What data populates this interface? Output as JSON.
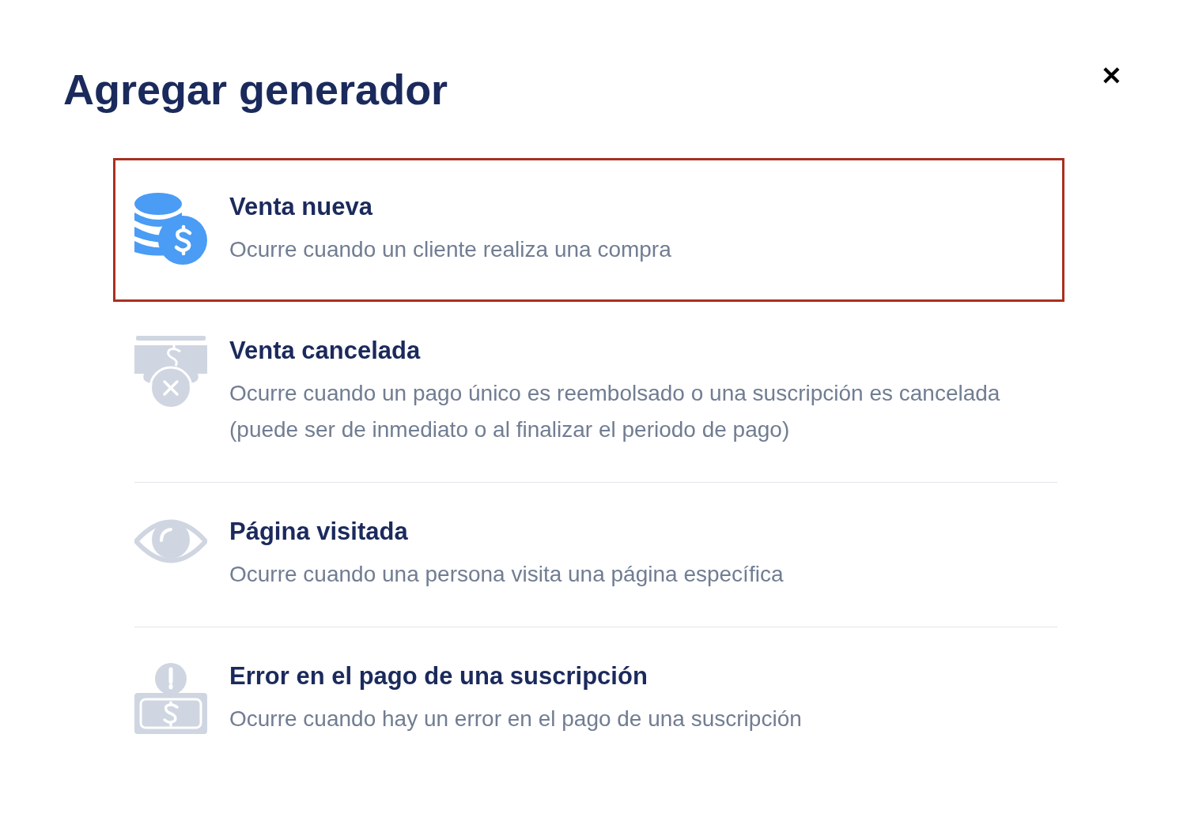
{
  "dialog": {
    "title": "Agregar generador",
    "close": "✕"
  },
  "triggers": [
    {
      "title": "Venta nueva",
      "description": "Ocurre cuando un cliente realiza una compra",
      "selected": true
    },
    {
      "title": "Venta cancelada",
      "description": "Ocurre cuando un pago único es reembolsado o una suscripción es cancelada (puede ser de inmediato o al finalizar el periodo de pago)",
      "selected": false
    },
    {
      "title": "Página visitada",
      "description": "Ocurre cuando una persona visita una página específica",
      "selected": false
    },
    {
      "title": "Error en el pago de una suscripción",
      "description": "Ocurre cuando hay un error en el pago de una suscripción",
      "selected": false
    }
  ]
}
